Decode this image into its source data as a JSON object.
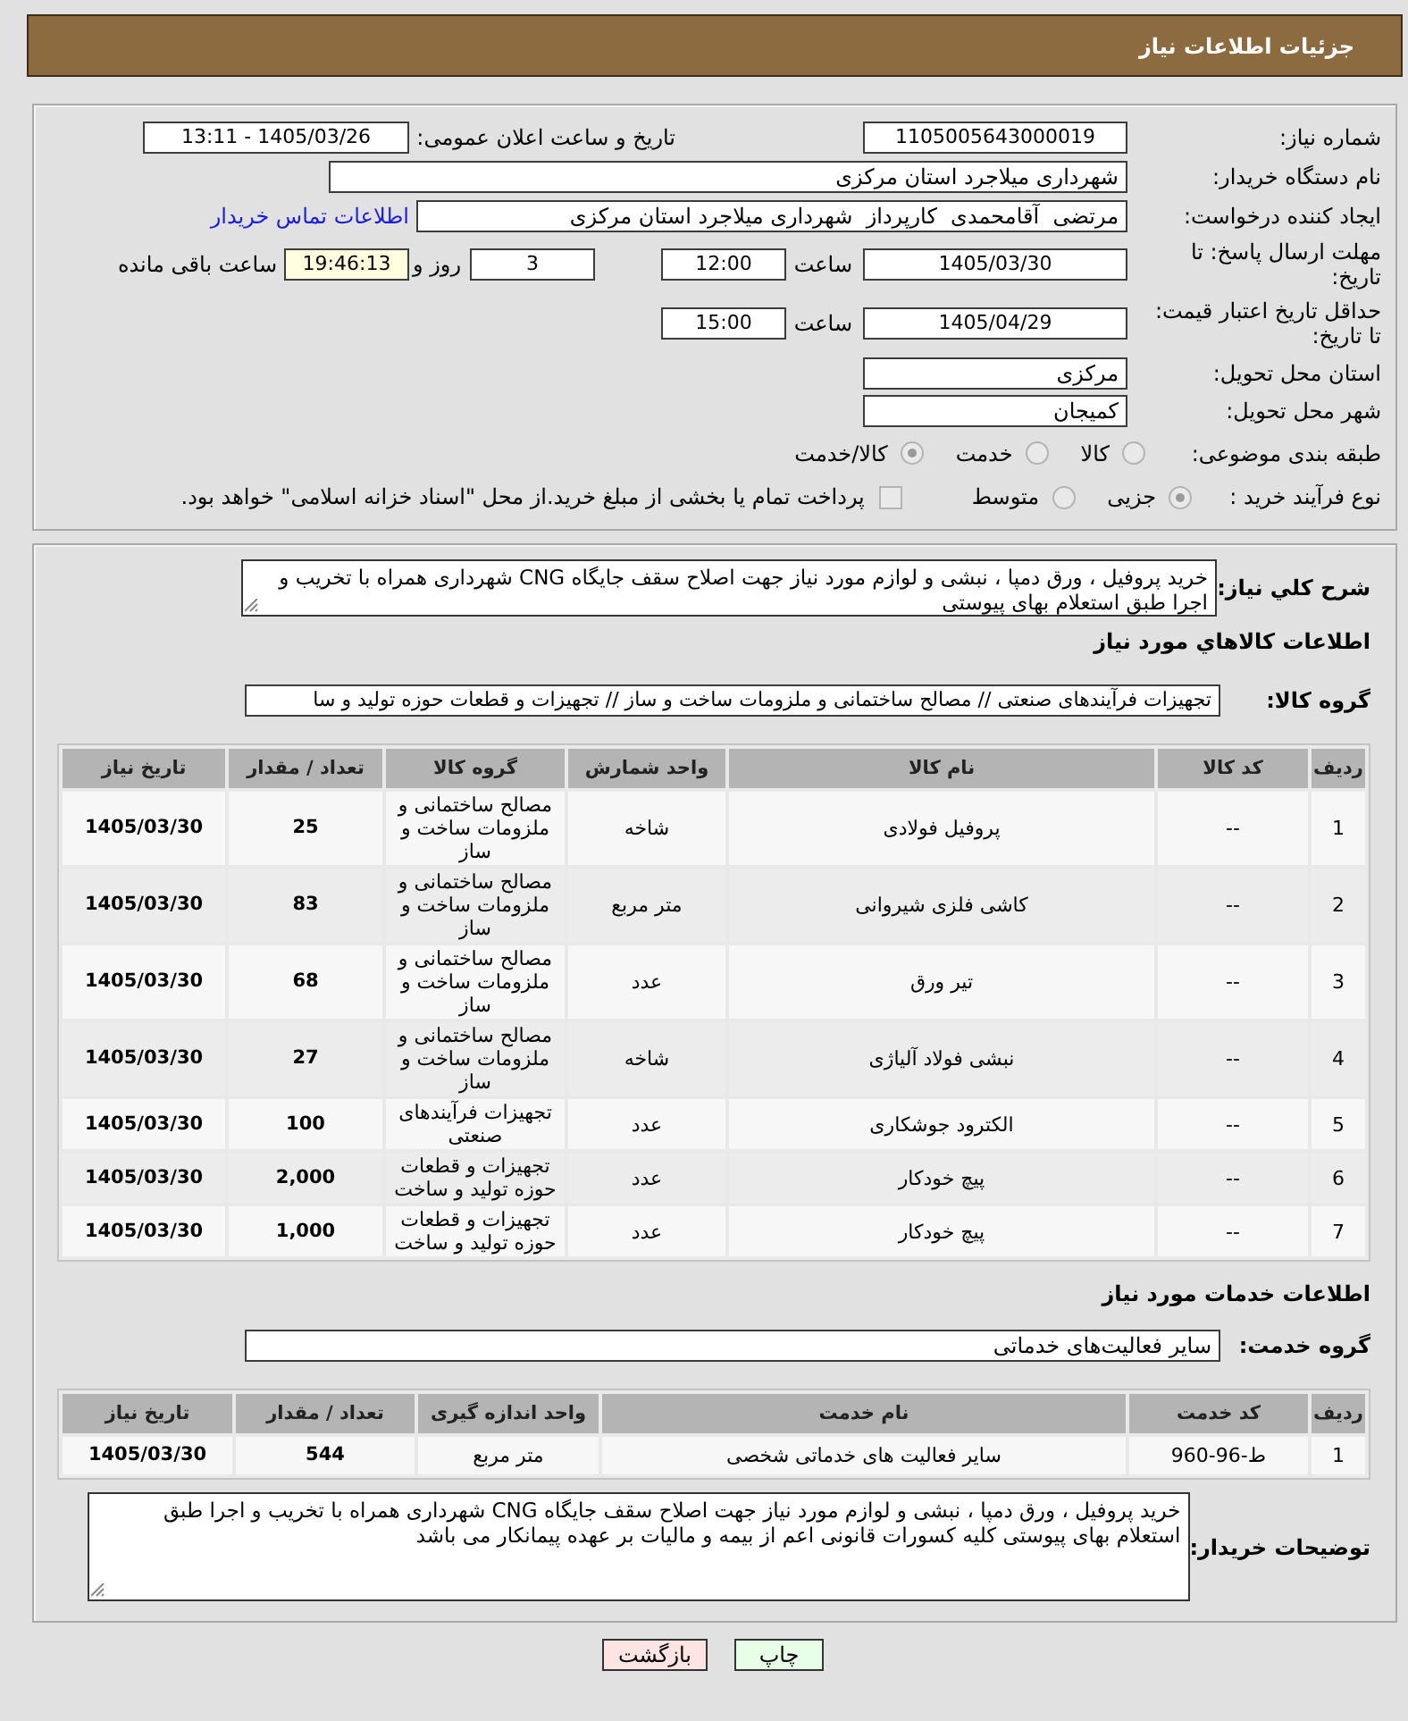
{
  "header": {
    "title": "جزئیات اطلاعات نیاز"
  },
  "details": {
    "need_number": {
      "label": "شماره نیاز:",
      "value": "1105005643000019"
    },
    "announcement": {
      "label": "تاریخ و ساعت اعلان عمومی:",
      "value": "1405/03/26 - 13:11"
    },
    "buyer_org": {
      "label": "نام دستگاه خریدار:",
      "value": "شهرداری میلاجرد استان مرکزی"
    },
    "requester": {
      "label": "ایجاد کننده درخواست:",
      "value": "مرتضی  آقامحمدی  کارپرداز  شهرداری میلاجرد استان مرکزی",
      "contact_link": "اطلاعات تماس خریدار"
    },
    "reply_deadline": {
      "label": "مهلت ارسال پاسخ: تا تاریخ:",
      "date": "1405/03/30",
      "time_label": "ساعت",
      "time": "12:00",
      "days": "3",
      "days_label": "روز و",
      "remaining": "19:46:13",
      "remaining_label": "ساعت باقی مانده"
    },
    "price_validity": {
      "label": "حداقل تاریخ اعتبار قیمت: تا تاریخ:",
      "date": "1405/04/29",
      "time_label": "ساعت",
      "time": "15:00"
    },
    "delivery_province": {
      "label": "استان محل تحویل:",
      "value": "مرکزی"
    },
    "delivery_city": {
      "label": "شهر محل تحویل:",
      "value": "کمیجان"
    },
    "category": {
      "label": "طبقه بندی موضوعی:",
      "options": [
        {
          "label": "کالا",
          "selected": false,
          "disabled": true
        },
        {
          "label": "خدمت",
          "selected": false,
          "disabled": true
        },
        {
          "label": "کالا/خدمت",
          "selected": true,
          "disabled": true
        }
      ]
    },
    "purchase_type": {
      "label": "نوع فرآیند خرید :",
      "options": [
        {
          "label": "جزیی",
          "selected": true,
          "disabled": true
        },
        {
          "label": "متوسط",
          "selected": false,
          "disabled": true
        }
      ],
      "treasury_payment": {
        "label": "پرداخت تمام یا بخشی از مبلغ خرید.از محل \"اسناد خزانه اسلامی\" خواهد بود.",
        "checked": false,
        "disabled": true
      }
    }
  },
  "summary": {
    "label": "شرح کلي نياز:",
    "value": "خرید پروفیل ، ورق دمپا ، نبشی و لوازم مورد نیاز جهت اصلاح سقف جایگاه CNG شهرداری همراه با تخریب و اجرا طبق استعلام بهای پیوستی"
  },
  "goods": {
    "heading": "اطلاعات کالاهاي مورد نياز",
    "group_label": "گروه کالا:",
    "group_value": "تجهیزات فرآیندهای صنعتی // مصالح ساختمانی و ملزومات ساخت و ساز // تجهیزات و قطعات حوزه تولید و سا",
    "table": {
      "columns": [
        "ردیف",
        "کد کالا",
        "نام کالا",
        "واحد شمارش",
        "گروه کالا",
        "تعداد / مقدار",
        "تاریخ نیاز"
      ],
      "rows": [
        [
          "1",
          "--",
          "پروفیل فولادی",
          "شاخه",
          "مصالح ساختمانی و ملزومات ساخت و ساز",
          "25",
          "1405/03/30"
        ],
        [
          "2",
          "--",
          "کاشی فلزی شیروانی",
          "متر مربع",
          "مصالح ساختمانی و ملزومات ساخت و ساز",
          "83",
          "1405/03/30"
        ],
        [
          "3",
          "--",
          "تیر ورق",
          "عدد",
          "مصالح ساختمانی و ملزومات ساخت و ساز",
          "68",
          "1405/03/30"
        ],
        [
          "4",
          "--",
          "نبشی فولاد آلیاژی",
          "شاخه",
          "مصالح ساختمانی و ملزومات ساخت و ساز",
          "27",
          "1405/03/30"
        ],
        [
          "5",
          "--",
          "الکترود جوشکاری",
          "عدد",
          "تجهیزات فرآیندهای صنعتی",
          "100",
          "1405/03/30"
        ],
        [
          "6",
          "--",
          "پیچ خودکار",
          "عدد",
          "تجهیزات و قطعات حوزه تولید و ساخت",
          "2,000",
          "1405/03/30"
        ],
        [
          "7",
          "--",
          "پیچ خودکار",
          "عدد",
          "تجهیزات و قطعات حوزه تولید و ساخت",
          "1,000",
          "1405/03/30"
        ]
      ]
    }
  },
  "services": {
    "heading": "اطلاعات خدمات مورد نیاز",
    "group_label": "گروه خدمت:",
    "group_value": "سایر فعالیت‌های خدماتی",
    "table": {
      "columns": [
        "ردیف",
        "کد خدمت",
        "نام خدمت",
        "واحد اندازه گیری",
        "تعداد / مقدار",
        "تاریخ نیاز"
      ],
      "rows": [
        [
          "1",
          "ط-96-960",
          "سایر فعالیت های خدماتی شخصی",
          "متر مربع",
          "544",
          "1405/03/30"
        ]
      ]
    }
  },
  "buyer_notes": {
    "label": "توضیحات خریدار:",
    "value": "خرید پروفیل ، ورق دمپا ، نبشی و لوازم مورد نیاز جهت اصلاح سقف جایگاه CNG شهرداری همراه با تخریب و اجرا طبق استعلام بهای پیوستی کلیه کسورات قانونی اعم از بیمه و مالیات بر عهده پیمانکار می باشد"
  },
  "buttons": [
    {
      "label": "چاپ",
      "kind": "print"
    },
    {
      "label": "بازگشت",
      "kind": "back"
    }
  ]
}
